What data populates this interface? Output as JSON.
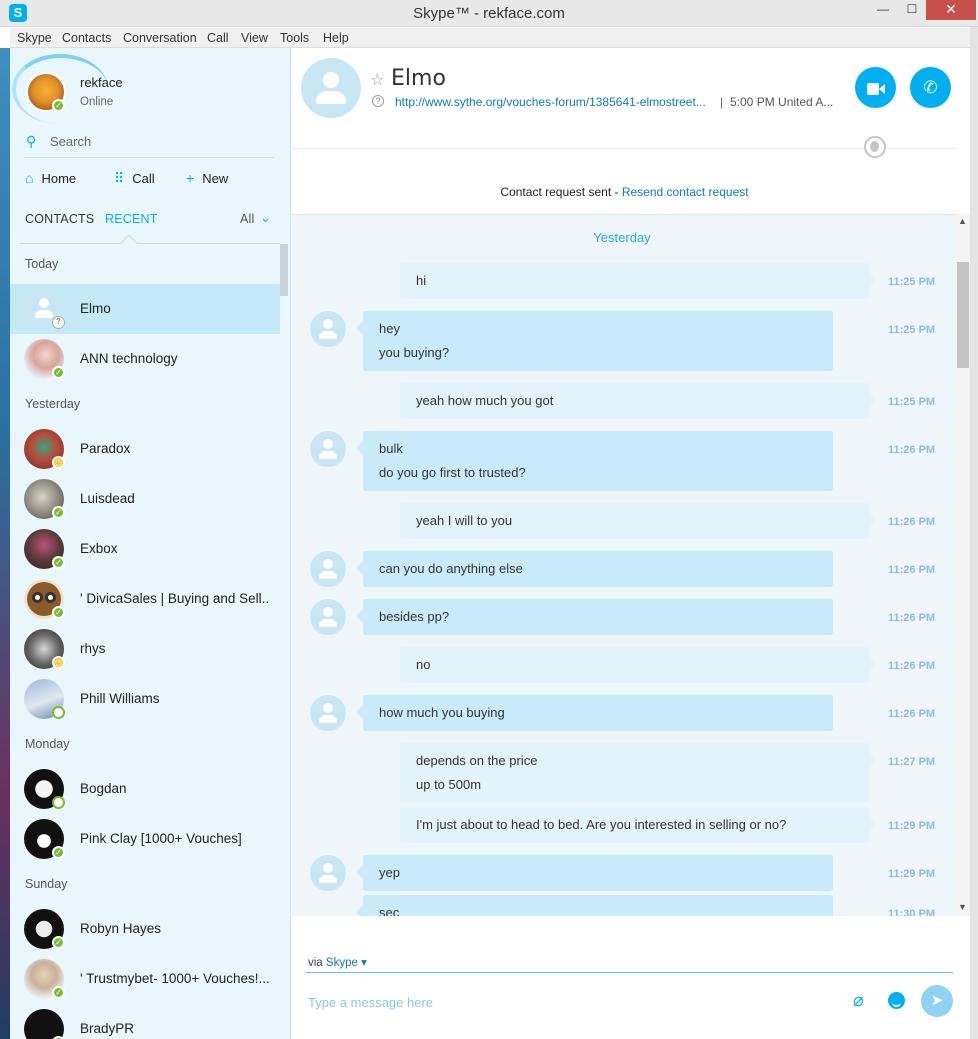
{
  "window": {
    "title": "Skype™ - rekface.com",
    "app_icon": "S",
    "min_label": "—",
    "max_label": "☐",
    "close_label": "✕"
  },
  "menu": [
    "Skype",
    "Contacts",
    "Conversation",
    "Call",
    "View",
    "Tools",
    "Help"
  ],
  "me": {
    "name": "rekface",
    "status": "Online"
  },
  "search": {
    "placeholder": "Search"
  },
  "nav": {
    "home": "Home",
    "call": "Call",
    "new": "New"
  },
  "tabs": {
    "contacts": "CONTACTS",
    "recent": "RECENT",
    "filter": "All"
  },
  "contacts": {
    "groups": {
      "today": "Today",
      "yesterday": "Yesterday",
      "monday": "Monday",
      "sunday": "Sunday"
    },
    "items": [
      {
        "name": "Elmo",
        "status": "pending",
        "selected": true
      },
      {
        "name": "ANN technology",
        "status": "online"
      },
      {
        "name": "Paradox",
        "status": "away"
      },
      {
        "name": "Luisdead",
        "status": "online"
      },
      {
        "name": "Exbox",
        "status": "online"
      },
      {
        "name": "' DivicaSales | Buying and Sell...",
        "status": "online"
      },
      {
        "name": "rhys",
        "status": "away"
      },
      {
        "name": "Phill Williams",
        "status": "offline"
      },
      {
        "name": "Bogdan",
        "status": "offline"
      },
      {
        "name": "Pink Clay [1000+ Vouches]",
        "status": "online"
      },
      {
        "name": "Robyn Hayes",
        "status": "online"
      },
      {
        "name": "' Trustmybet- 1000+ Vouches!...",
        "status": "online"
      },
      {
        "name": "BradyPR",
        "status": "online"
      }
    ]
  },
  "conversation": {
    "name": "Elmo",
    "mood_link": "http://www.sythe.org/vouches-forum/1385641-elmostreet...",
    "separator": "|",
    "local_time": "5:00 PM United A...",
    "request_text": "Contact request sent - ",
    "request_link": "Resend contact request",
    "day_label": "Yesterday",
    "messages": [
      {
        "from": "me",
        "lines": [
          "hi"
        ],
        "time": "11:25 PM"
      },
      {
        "from": "them",
        "lines": [
          "hey",
          "you buying?"
        ],
        "time": "11:25 PM"
      },
      {
        "from": "me",
        "lines": [
          "yeah how much you got"
        ],
        "time": "11:25 PM"
      },
      {
        "from": "them",
        "lines": [
          "bulk",
          "do you go first to trusted?"
        ],
        "time": "11:26 PM"
      },
      {
        "from": "me",
        "lines": [
          "yeah I will to you"
        ],
        "time": "11:26 PM"
      },
      {
        "from": "them",
        "lines": [
          "can you do anything else"
        ],
        "time": "11:26 PM"
      },
      {
        "from": "them",
        "lines": [
          "besides pp?"
        ],
        "time": "11:26 PM"
      },
      {
        "from": "me",
        "lines": [
          "no"
        ],
        "time": "11:26 PM"
      },
      {
        "from": "them",
        "lines": [
          "how much you buying"
        ],
        "time": "11:26 PM"
      },
      {
        "from": "me",
        "lines": [
          "depends on the price",
          "up to 500m"
        ],
        "time": "11:27 PM"
      },
      {
        "from": "me",
        "lines": [
          "I'm just about to head to bed.  Are you interested in selling or no?"
        ],
        "time": "11:29 PM"
      },
      {
        "from": "them",
        "lines": [
          "yep"
        ],
        "time": "11:29 PM"
      },
      {
        "from": "them",
        "lines": [
          "sec"
        ],
        "time": "11:30 PM"
      }
    ]
  },
  "composer": {
    "via_text": "via ",
    "via_link": "Skype",
    "placeholder": "Type a message here"
  },
  "colors": {
    "accent": "#00aff0",
    "online": "#7cbb35",
    "away": "#f4c522"
  }
}
